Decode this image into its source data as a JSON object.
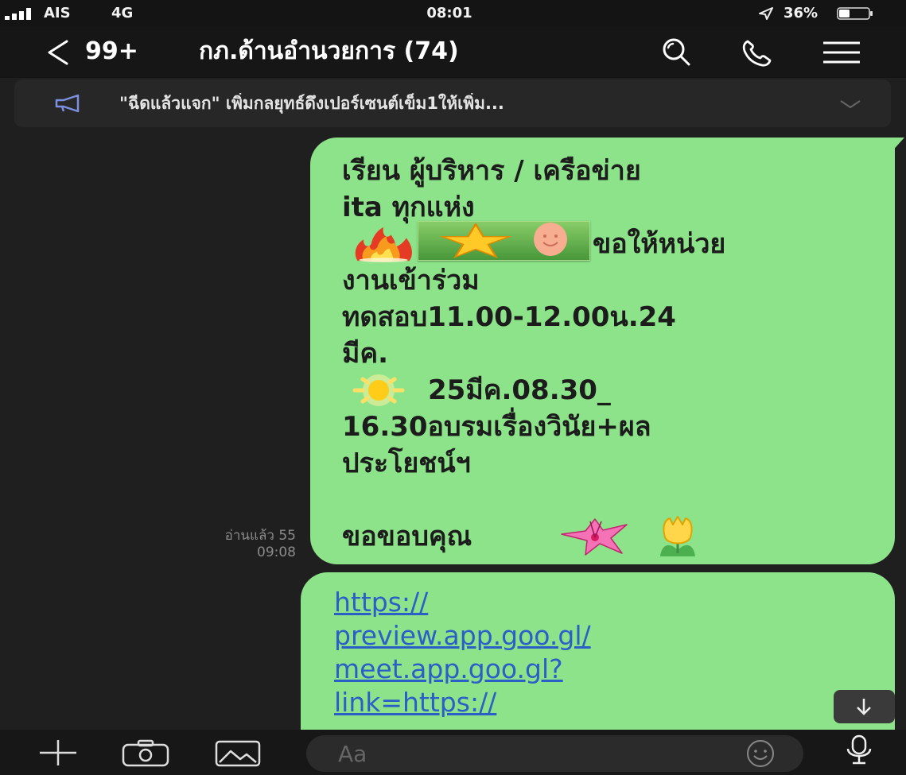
{
  "status_bar": {
    "carrier": "AIS",
    "network": "4G",
    "time": "08:01",
    "battery_percent": "36%",
    "battery_level": 0.36,
    "icons": [
      "signal-bars-icon",
      "location-arrow-icon",
      "battery-icon"
    ]
  },
  "header": {
    "back_label": "99+",
    "title": "กภ.ด้านอำนวยการ (74)",
    "icons": [
      "back-chevron-icon",
      "search-icon",
      "phone-icon",
      "menu-icon"
    ]
  },
  "announcement": {
    "text": "\"ฉีดแล้วแจก\" เพิ่มกลยุทธ์ดึงเปอร์เซนต์เข็ม1ให้เพิ่ม...",
    "icons": [
      "megaphone-icon",
      "chevron-down-icon"
    ]
  },
  "messages": [
    {
      "lines": [
        "เรียน ผู้บริหาร / เครือข่าย",
        "ita ทุกแห่ง",
        "ขอให้หน่วย",
        "งานเข้าร่วม",
        "ทดสอบ11.00-12.00น.24",
        "มีค.",
        "25มีค.08.30_",
        "16.30อบรมเรื่องวินัย+ผล",
        "ประโยชน์ฯ",
        "ขอขอบคุณ"
      ],
      "inline_icons": [
        "fire-emoji",
        "star-smiley-sticker",
        "sun-emoji",
        "pink-flower-emoji",
        "yellow-tulip-emoji"
      ],
      "read_label": "อ่านแล้ว 55",
      "time": "09:08"
    },
    {
      "link_lines": [
        "https://",
        "preview.app.goo.gl/",
        "meet.app.goo.gl?",
        "link=https://"
      ]
    }
  ],
  "input": {
    "placeholder": "Aa",
    "icons": [
      "plus-icon",
      "camera-icon",
      "image-icon",
      "emoji-icon",
      "microphone-icon"
    ]
  },
  "scroll_button_icon": "arrow-down-icon",
  "colors": {
    "background": "#1f1f1f",
    "bubble": "#8de389",
    "link": "#2b5fc8",
    "muted_text": "#8b8b8b"
  }
}
